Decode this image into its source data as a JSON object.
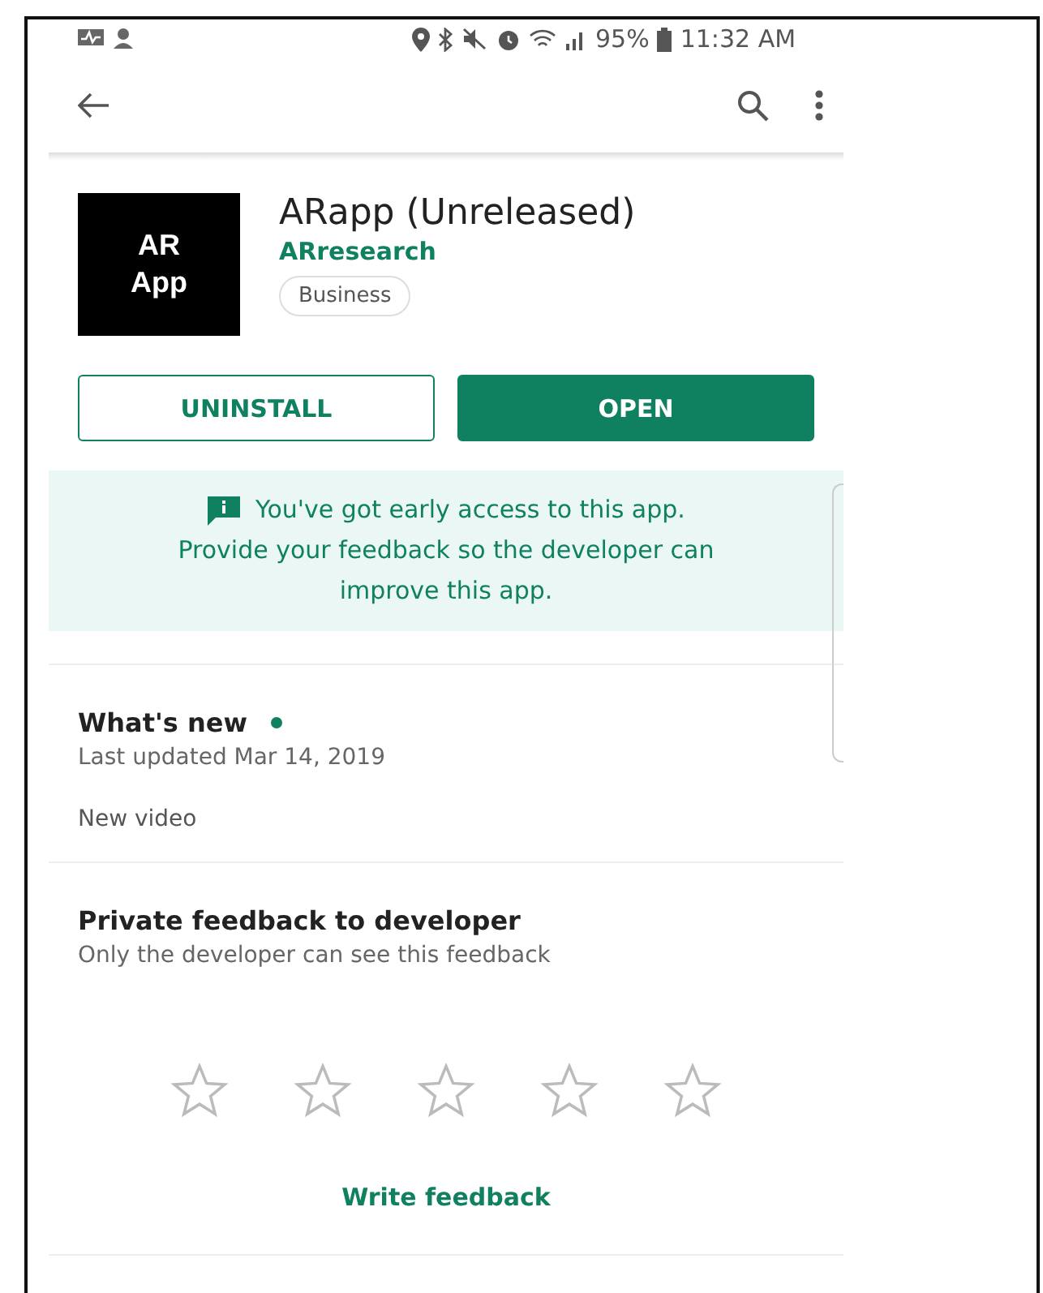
{
  "status_bar": {
    "battery": "95%",
    "time": "11:32 AM"
  },
  "app": {
    "icon_lines": [
      "AR",
      "App"
    ],
    "title": "ARapp (Unreleased)",
    "developer": "ARresearch",
    "category": "Business"
  },
  "buttons": [
    {
      "label": "UNINSTALL",
      "kind": "outline"
    },
    {
      "label": "OPEN",
      "kind": "filled"
    }
  ],
  "banner": {
    "lines": [
      "You've got early access to this app.",
      "Provide your feedback so the developer can",
      "improve this app."
    ]
  },
  "whats_new": {
    "title": "What's new",
    "updated": "Last updated Mar 14, 2019",
    "notes": "New video"
  },
  "feedback": {
    "title": "Private feedback to developer",
    "subtitle": "Only the developer can see this feedback",
    "stars": 0,
    "link": "Write feedback"
  }
}
